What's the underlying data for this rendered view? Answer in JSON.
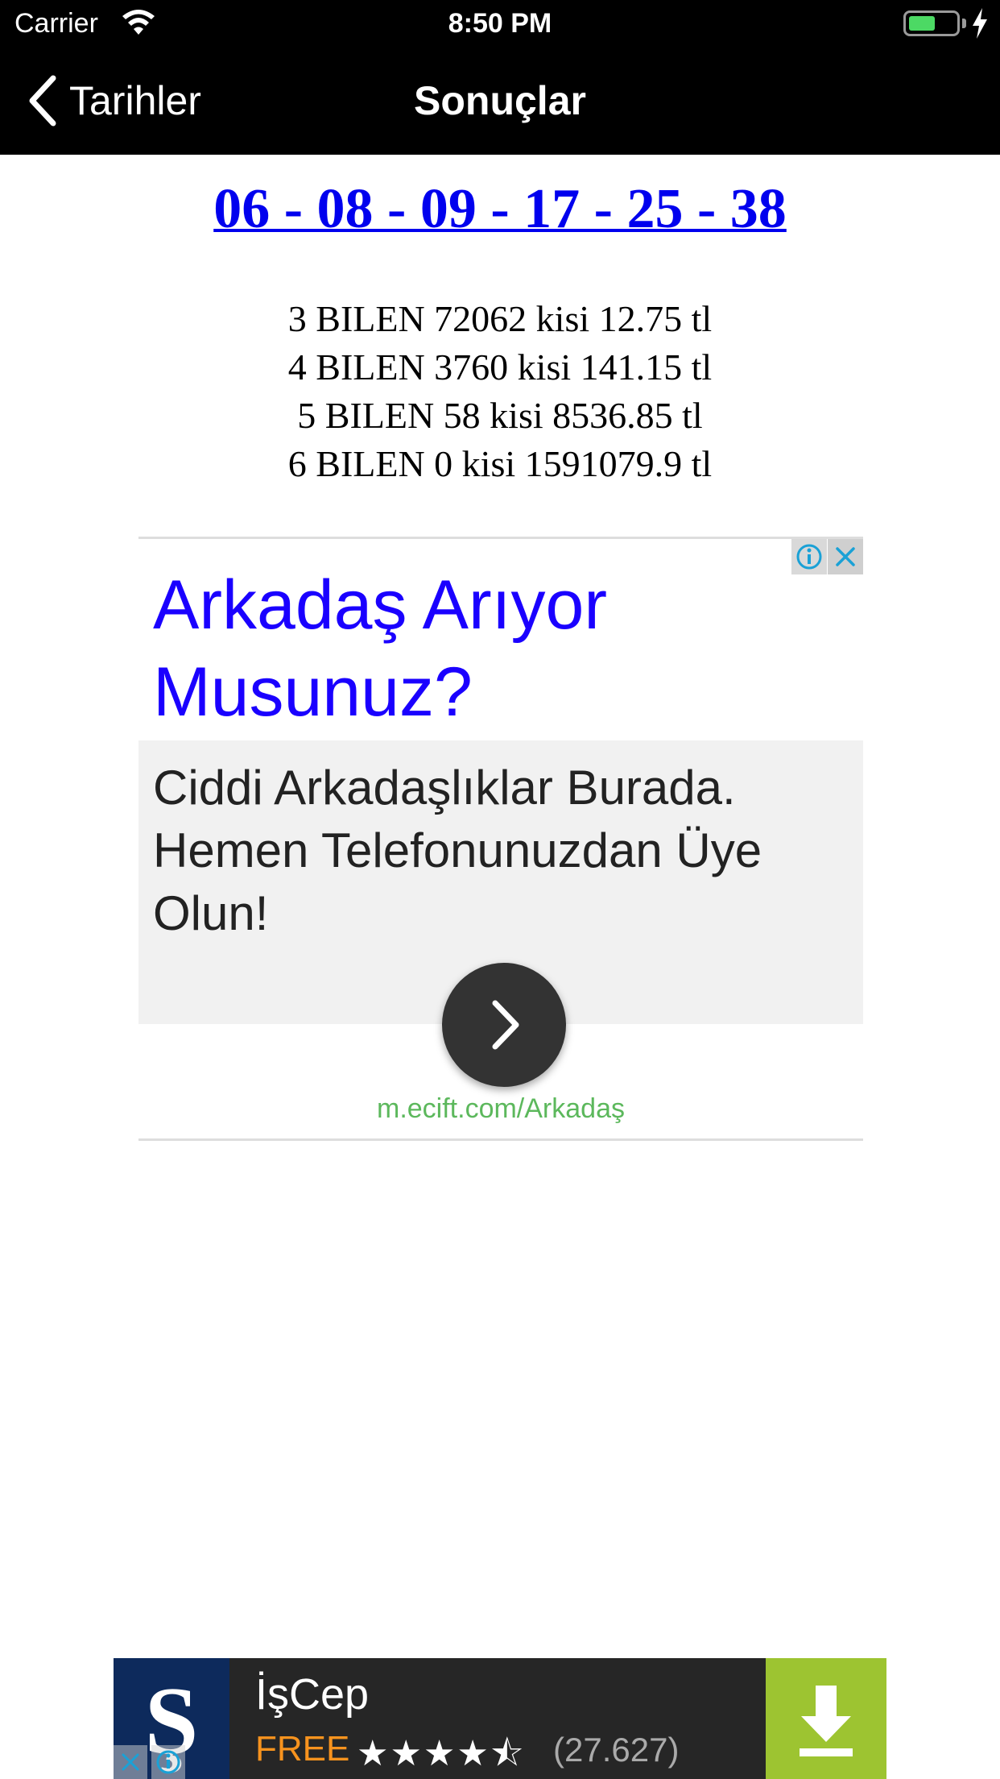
{
  "status_bar": {
    "carrier": "Carrier",
    "time": "8:50 PM",
    "battery_level": 0.55
  },
  "nav": {
    "back_label": "Tarihler",
    "title": "Sonuçlar"
  },
  "draw": {
    "numbers": "06 - 08 - 09 - 17 - 25 - 38",
    "results": [
      "3 BILEN 72062 kisi 12.75 tl",
      "4 BILEN 3760 kisi 141.15 tl",
      "5 BILEN 58 kisi 8536.85 tl",
      "6 BILEN 0 kisi 1591079.9 tl"
    ]
  },
  "ad": {
    "title": "Arkadaş Arıyor Musunuz?",
    "description": "Ciddi Arkadaşlıklar Burada. Hemen Telefonunuzdan Üye Olun!",
    "url": "m.ecift.com/Arkadaş",
    "colors": {
      "title": "#1a00ff",
      "url": "#5cb85c"
    }
  },
  "banner": {
    "app_name": "İşCep",
    "price": "FREE",
    "stars": "★★★★⯪",
    "star_rating": 4.5,
    "rating_count": "(27.627)",
    "colors": {
      "price": "#f7931e",
      "download": "#9dc431"
    }
  }
}
